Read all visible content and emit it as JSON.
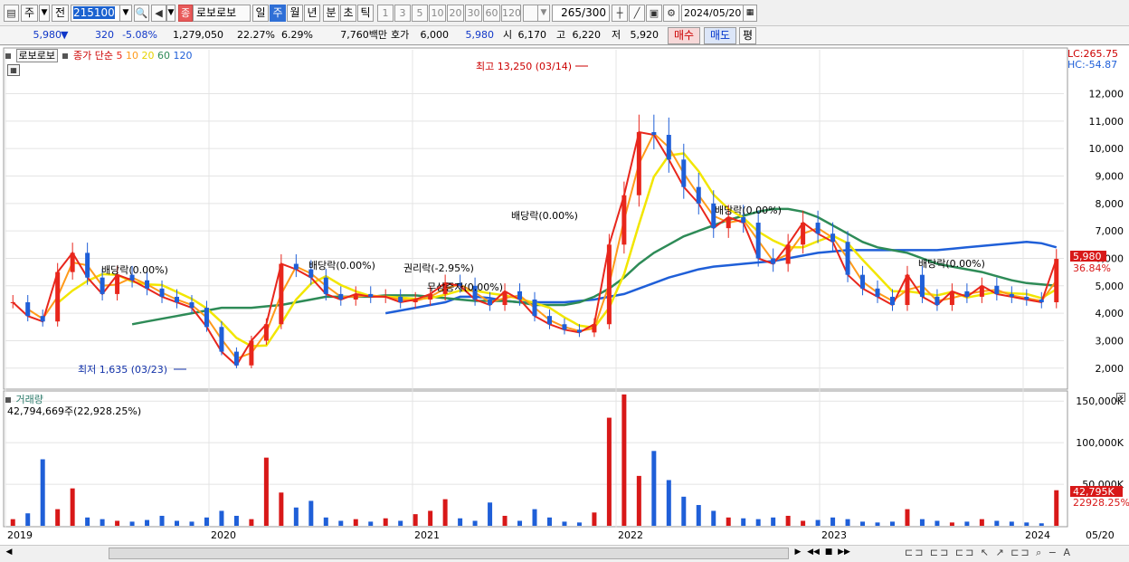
{
  "toolbar": {
    "period_label": "주",
    "prev_label": "전",
    "code_value": "215100",
    "name_badge": "종",
    "stock_name": "로보로보",
    "periods": [
      "일",
      "주",
      "월",
      "년",
      "분",
      "초",
      "틱"
    ],
    "selected_period": "주",
    "intervals": [
      "1",
      "3",
      "5",
      "10",
      "20",
      "30",
      "60",
      "120"
    ],
    "count_value": "265",
    "count_total": "/300",
    "date_value": "2024/05/20"
  },
  "infobar": {
    "price": "5,980",
    "change_arrow": "▼",
    "change": "320",
    "change_pct": "-5.08%",
    "volume": "1,279,050",
    "turnover_pct": "22.27%",
    "other_pct": "6.29%",
    "amount": "7,760백만",
    "ask_label": "호가",
    "ask_value": "6,000",
    "bid_value": "5,980",
    "open_label": "시",
    "open_value": "6,170",
    "high_label": "고",
    "high_value": "6,220",
    "low_label": "저",
    "low_value": "5,920",
    "buy_label": "매수",
    "sell_label": "매도",
    "eval_label": "평"
  },
  "chart": {
    "stock_label": "로보로보",
    "ma_title": "종가 단순",
    "ma_periods": [
      "5",
      "10",
      "20",
      "60",
      "120"
    ],
    "ma_colors": [
      "#e8261c",
      "#ff9a1a",
      "#f2e600",
      "#2e8b57",
      "#1f5fd8"
    ],
    "lc_label": "LC:265.75",
    "hc_label": "HC:-54.87",
    "price_axis": [
      "12,000",
      "11,000",
      "10,000",
      "9,000",
      "8,000",
      "7,000",
      "6,000",
      "5,000",
      "4,000",
      "3,000",
      "2,000"
    ],
    "current_price": "5,980",
    "current_pct": "36.84%",
    "max_label": "최고 13,250 (03/14)",
    "min_label": "최저 1,635 (03/23)",
    "annotations": [
      "배당락(0.00%)",
      "배당락(0.00%)",
      "권리락(-2.95%)",
      "무상증자(0.00%)",
      "배당락(0.00%)",
      "배당락(0.00%)",
      "배당락(0.00%)"
    ],
    "volume_label": "거래량",
    "volume_value": "42,794,669주(22,928.25%)",
    "volume_axis": [
      "150,000K",
      "100,000K",
      "50,000K"
    ],
    "volume_current": "42,795K",
    "volume_pct": "22928.25%",
    "x_axis": [
      "2019",
      "2020",
      "2021",
      "2022",
      "2023",
      "2024"
    ],
    "x_right": "05/20"
  },
  "chart_data": {
    "type": "candlestick",
    "title": "",
    "period": "weekly",
    "x": [
      "2019",
      "2020",
      "2021",
      "2022",
      "2023",
      "2024"
    ],
    "ylim": [
      1300,
      13600
    ],
    "close_series": [
      4400,
      3900,
      3700,
      5500,
      6200,
      5300,
      4700,
      5400,
      5200,
      4900,
      4600,
      4400,
      4200,
      3500,
      2600,
      2100,
      3000,
      3600,
      5800,
      5600,
      5300,
      4700,
      4500,
      4700,
      4600,
      4600,
      4400,
      4500,
      4700,
      5100,
      5000,
      4500,
      4300,
      4800,
      4500,
      3900,
      3600,
      3400,
      3300,
      3600,
      6500,
      8300,
      10600,
      10500,
      9600,
      8600,
      8000,
      7100,
      7500,
      7300,
      6000,
      5800,
      6500,
      7300,
      6900,
      6600,
      5400,
      4900,
      4600,
      4300,
      5400,
      4600,
      4300,
      4800,
      4600,
      5000,
      4700,
      4600,
      4500,
      4400,
      5980
    ],
    "ma120_series": [
      null,
      null,
      null,
      null,
      null,
      null,
      null,
      null,
      null,
      null,
      null,
      null,
      null,
      null,
      null,
      null,
      null,
      null,
      null,
      null,
      null,
      null,
      null,
      null,
      null,
      4000,
      4100,
      4200,
      4300,
      4400,
      4600,
      4600,
      4550,
      4450,
      4400,
      4400,
      4400,
      4400,
      4450,
      4500,
      4600,
      4700,
      4900,
      5100,
      5300,
      5450,
      5600,
      5700,
      5750,
      5800,
      5850,
      5900,
      6000,
      6100,
      6200,
      6250,
      6300,
      6300,
      6300,
      6300,
      6300,
      6300,
      6300,
      6350,
      6400,
      6450,
      6500,
      6550,
      6600,
      6550,
      6400
    ],
    "ma60_series": [
      null,
      null,
      null,
      null,
      null,
      null,
      null,
      null,
      3600,
      3700,
      3800,
      3900,
      4000,
      4100,
      4200,
      4200,
      4200,
      4250,
      4300,
      4400,
      4500,
      4600,
      4600,
      4600,
      4600,
      4650,
      4650,
      4650,
      4600,
      4550,
      4500,
      4450,
      4450,
      4450,
      4400,
      4300,
      4300,
      4300,
      4400,
      4600,
      4900,
      5300,
      5800,
      6200,
      6500,
      6800,
      7000,
      7200,
      7400,
      7550,
      7700,
      7800,
      7800,
      7700,
      7500,
      7200,
      6900,
      6600,
      6400,
      6300,
      6200,
      6000,
      5800,
      5700,
      5600,
      5500,
      5350,
      5200,
      5100,
      5050,
      5000
    ],
    "volume_ylim": [
      0,
      160000
    ],
    "volume_series": [
      8000,
      15000,
      80000,
      20000,
      45000,
      10000,
      8000,
      6000,
      5000,
      7000,
      12000,
      6000,
      5000,
      10000,
      18000,
      12000,
      8000,
      82000,
      40000,
      22000,
      30000,
      10000,
      6000,
      8000,
      5000,
      9000,
      6000,
      14000,
      18000,
      32000,
      9000,
      6000,
      28000,
      12000,
      6000,
      20000,
      10000,
      5000,
      4000,
      16000,
      130000,
      158000,
      60000,
      90000,
      55000,
      35000,
      25000,
      18000,
      10000,
      9000,
      8000,
      10000,
      12000,
      6000,
      7000,
      10000,
      8000,
      5000,
      4000,
      5000,
      20000,
      8000,
      6000,
      4000,
      5000,
      8000,
      6000,
      5000,
      4000,
      3000,
      42795
    ]
  },
  "status": {
    "nav_icons": [
      "play-icon",
      "rewind-icon",
      "stop-icon",
      "fast-forward-icon"
    ]
  }
}
